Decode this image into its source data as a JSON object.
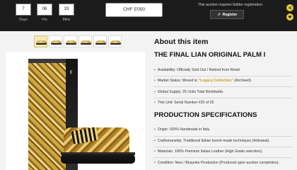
{
  "countdown": {
    "days": {
      "value": "7",
      "label": "Days"
    },
    "hours": {
      "value": "06",
      "label": "Hrs"
    },
    "minutes": {
      "value": "33",
      "label": "Mins"
    }
  },
  "bid": {
    "value": "CHF 5'050"
  },
  "registration": {
    "notice": "This auction requires bidder registration.",
    "button_label": "Register"
  },
  "side_actions": [
    {
      "icon": "share-icon"
    },
    {
      "icon": "heart-icon"
    }
  ],
  "gallery": {
    "thumbnails": [
      "thumb-1",
      "thumb-2",
      "thumb-3",
      "thumb-4",
      "thumb-5",
      "thumb-6"
    ]
  },
  "about": {
    "heading": "About this item",
    "title": "THE FINAL LIAN ORIGINAL PALM I",
    "items": [
      {
        "label": "Availability: Officially Sold Out / Retired from Retail."
      },
      {
        "label_before": "Market Status: Moved to ",
        "label_highlight": "\"Legacy Collection\"",
        "label_after": " (Archived)."
      },
      {
        "label": "Global Supply: 25 Units Total Worldwide."
      },
      {
        "label": "This Unit: Serial Number #25 of 25"
      }
    ]
  },
  "production": {
    "heading": "PRODUCTION SPECIFICATIONS",
    "items": [
      {
        "label": "Origin: 100% Handmade in Italy."
      },
      {
        "label": "Craftsmanship: Traditional Italian bench-made techniques (Artisanal)."
      },
      {
        "label": "Materials: 100% Premium Italian Leather (High Grade selection)."
      },
      {
        "label": "Condition: New / Bespoke Production (Produced upon auction completion)."
      }
    ]
  },
  "colors": {
    "topbar": "#1b1b1b",
    "accent_gold": "#c79d1a",
    "side_button": "#e3c83d"
  }
}
